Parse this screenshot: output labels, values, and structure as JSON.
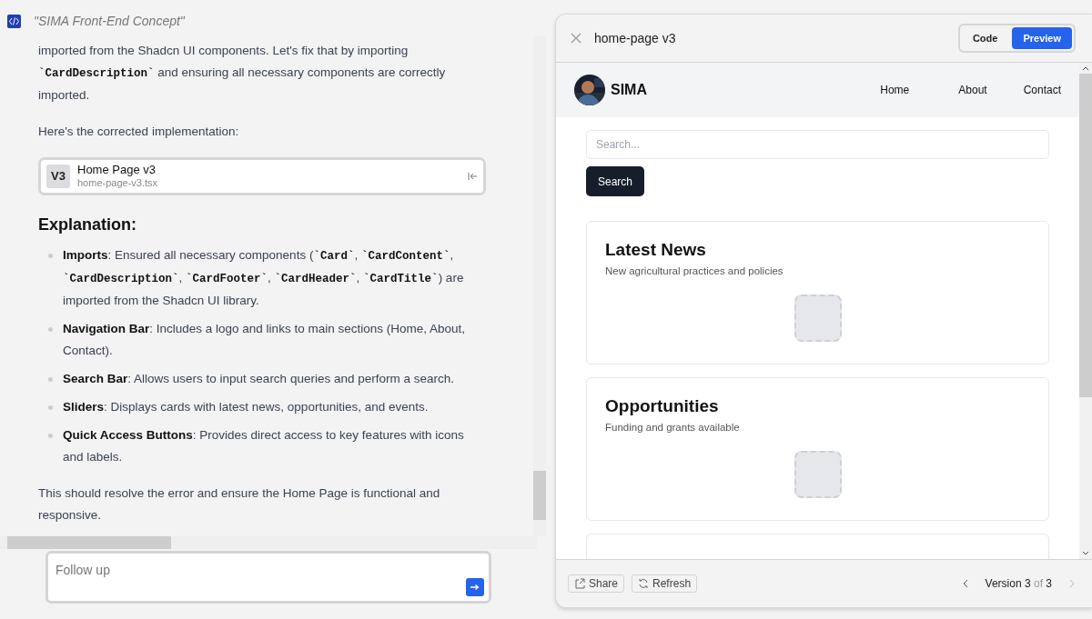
{
  "chat": {
    "title": "\"SIMA Front-End Concept\"",
    "paragraphs": [
      {
        "kind": "paragraph",
        "runs": [
          {
            "kind": "text",
            "text": "imported from the Shadcn UI components. Let's fix that by importing "
          },
          {
            "kind": "code",
            "text": "`CardDescription`"
          },
          {
            "kind": "text",
            "text": " and ensuring all necessary components are correctly imported."
          }
        ]
      },
      {
        "kind": "paragraph",
        "runs": [
          {
            "kind": "text",
            "text": "Here's the corrected implementation:"
          }
        ]
      },
      {
        "kind": "file",
        "badge": "V3",
        "title": "Home Page v3",
        "filename": "home-page-v3.tsx"
      },
      {
        "kind": "heading",
        "runs": [
          {
            "kind": "text",
            "text": "Explanation:"
          }
        ]
      },
      {
        "kind": "bullet",
        "runs": [
          {
            "kind": "strong",
            "text": "Imports"
          },
          {
            "kind": "text",
            "text": ": Ensured all necessary components ("
          },
          {
            "kind": "code",
            "text": "`Card`"
          },
          {
            "kind": "text",
            "text": ", "
          },
          {
            "kind": "code",
            "text": "`CardContent`"
          },
          {
            "kind": "text",
            "text": ", "
          },
          {
            "kind": "code",
            "text": "`CardDescription`"
          },
          {
            "kind": "text",
            "text": ", "
          },
          {
            "kind": "code",
            "text": "`CardFooter`"
          },
          {
            "kind": "text",
            "text": ", "
          },
          {
            "kind": "code",
            "text": "`CardHeader`"
          },
          {
            "kind": "text",
            "text": ", "
          },
          {
            "kind": "code",
            "text": "`CardTitle`"
          },
          {
            "kind": "text",
            "text": ") are imported from the Shadcn UI library."
          }
        ]
      },
      {
        "kind": "bullet",
        "runs": [
          {
            "kind": "strong",
            "text": "Navigation Bar"
          },
          {
            "kind": "text",
            "text": ": Includes a logo and links to main sections (Home, About, Contact)."
          }
        ]
      },
      {
        "kind": "bullet",
        "runs": [
          {
            "kind": "strong",
            "text": "Search Bar"
          },
          {
            "kind": "text",
            "text": ": Allows users to input search queries and perform a search."
          }
        ]
      },
      {
        "kind": "bullet",
        "runs": [
          {
            "kind": "strong",
            "text": "Sliders"
          },
          {
            "kind": "text",
            "text": ": Displays cards with latest news, opportunities, and events."
          }
        ]
      },
      {
        "kind": "bullet",
        "runs": [
          {
            "kind": "strong",
            "text": "Quick Access Buttons"
          },
          {
            "kind": "text",
            "text": ": Provides direct access to key features with icons and labels."
          }
        ]
      },
      {
        "kind": "paragraph",
        "runs": [
          {
            "kind": "text",
            "text": "This should resolve the error and ensure the Home Page is functional and responsive."
          }
        ]
      }
    ],
    "input": {
      "placeholder": "Follow up"
    }
  },
  "preview": {
    "title": "home-page v3",
    "view_tabs": [
      {
        "label": "Code",
        "selected": false
      },
      {
        "label": "Preview",
        "selected": true
      }
    ],
    "site": {
      "brand": "SIMA",
      "nav": [
        "Home",
        "About",
        "Contact"
      ],
      "search": {
        "placeholder": "Search...",
        "button": "Search"
      },
      "cards": [
        {
          "kind": "card",
          "title": "Latest News",
          "description": "New agricultural practices and policies"
        },
        {
          "kind": "card",
          "title": "Opportunities",
          "description": "Funding and grants available"
        },
        {
          "kind": "cut"
        }
      ]
    },
    "footer": {
      "buttons": [
        "Share",
        "Refresh"
      ],
      "version": {
        "label": "Version",
        "current": "3",
        "of": "of",
        "total": "3"
      }
    }
  }
}
